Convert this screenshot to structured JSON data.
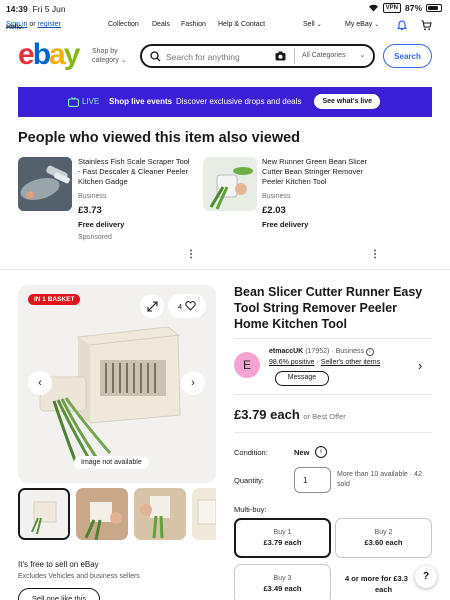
{
  "status_bar": {
    "time": "14:39",
    "date": "Fri 5 Jun",
    "vpn": "VPN",
    "battery": "87%"
  },
  "topnav": {
    "hello": "Hello.",
    "sign_in": "Sign in",
    "or": "or",
    "register": "register",
    "collection": "Collection",
    "deals": "Deals",
    "fashion": "Fashion",
    "help": "Help & Contact",
    "sell": "Sell",
    "my_ebay": "My eBay"
  },
  "header": {
    "logo": {
      "e": "e",
      "b": "b",
      "a": "a",
      "y": "y"
    },
    "shop_by_line1": "Shop by",
    "shop_by_line2": "category",
    "search_placeholder": "Search for anything",
    "category": "All Categories",
    "search_button": "Search"
  },
  "banner": {
    "live": "LIVE",
    "headline": "Shop live events",
    "text": "Discover exclusive drops and deals",
    "cta": "See what's live"
  },
  "also_viewed": {
    "heading": "People who viewed this item also viewed",
    "items": [
      {
        "title": "Stainless Fish Scale Scraper Tool - Fast Descaler & Cleaner Peeler Kitchen Gadge",
        "seller_type": "Business",
        "price": "£3.73",
        "delivery": "Free delivery",
        "tag": "Sponsored"
      },
      {
        "title": "New Runner Green Bean Slicer Cutter Bean Stringer Remover Peeler Kitchen Tool",
        "seller_type": "Business",
        "price": "£2.03",
        "delivery": "Free delivery",
        "tag": ""
      }
    ]
  },
  "gallery": {
    "badge": "IN 1 BASKET",
    "watch_count": "4",
    "no_image": "Image not available",
    "thumbnails": 4
  },
  "product": {
    "title": "Bean Slicer Cutter Runner Easy Tool String Remover Peeler Home Kitchen Tool",
    "seller": {
      "avatar_letter": "E",
      "name": "etmaccUK",
      "feedback": "(17952)",
      "type": "· Business",
      "positive": "98.6% positive",
      "dot": "·",
      "other_items": "Seller's other items",
      "message": "Message"
    },
    "price": "£3.79 each",
    "price_suffix": "or Best Offer",
    "condition_label": "Condition:",
    "condition": "New",
    "quantity_label": "Quantity:",
    "quantity_value": "1",
    "availability": "More than 10 available · 42 sold",
    "multibuy_label": "Multi-buy:",
    "multibuy": [
      {
        "label": "Buy 1",
        "price": "£3.79 each"
      },
      {
        "label": "Buy 2",
        "price": "£3.60 each"
      },
      {
        "label": "Buy 3",
        "price": "£3.49 each"
      },
      {
        "label": "4 or more for £3.3",
        "price": "each"
      }
    ]
  },
  "sell_promo": {
    "heading": "It's free to sell on eBay",
    "sub": "Excludes Vehicles and business sellers",
    "button": "Sell one like this"
  },
  "help_fab": "?"
}
